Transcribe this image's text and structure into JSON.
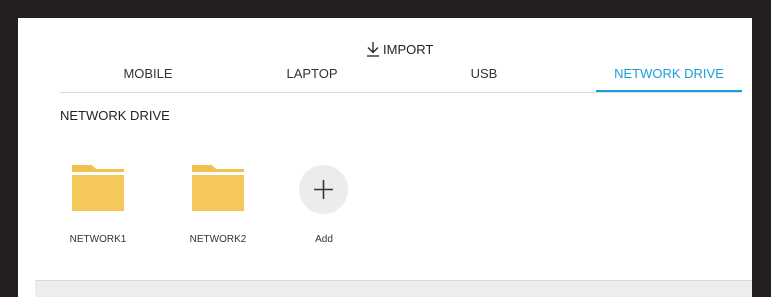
{
  "header": {
    "title": "IMPORT",
    "icon": "import-download-icon"
  },
  "tabs": [
    {
      "label": "MOBILE",
      "active": false
    },
    {
      "label": "LAPTOP",
      "active": false
    },
    {
      "label": "USB",
      "active": false
    },
    {
      "label": "NETWORK DRIVE",
      "active": true
    }
  ],
  "section": {
    "title": "NETWORK DRIVE"
  },
  "items": [
    {
      "label": "NETWORK1",
      "icon": "folder-icon"
    },
    {
      "label": "NETWORK2",
      "icon": "folder-icon"
    },
    {
      "label": "Add",
      "icon": "plus-icon"
    }
  ],
  "colors": {
    "accent": "#1a9ed8",
    "folder": "#f5c85c",
    "folder_tab": "#f2c04e",
    "frame": "#231f20",
    "add_background": "#ececec"
  }
}
